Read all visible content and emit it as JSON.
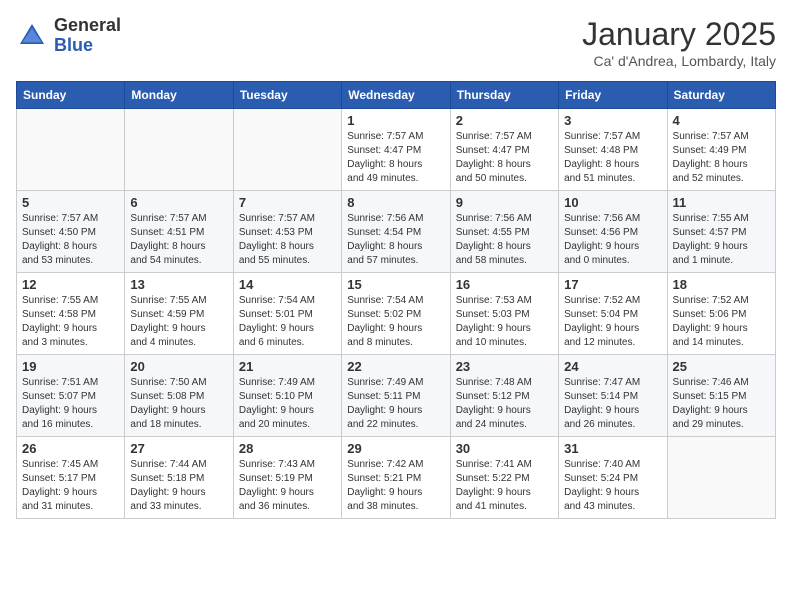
{
  "logo": {
    "general": "General",
    "blue": "Blue"
  },
  "title": "January 2025",
  "subtitle": "Ca' d'Andrea, Lombardy, Italy",
  "days_of_week": [
    "Sunday",
    "Monday",
    "Tuesday",
    "Wednesday",
    "Thursday",
    "Friday",
    "Saturday"
  ],
  "weeks": [
    [
      {
        "day": "",
        "info": ""
      },
      {
        "day": "",
        "info": ""
      },
      {
        "day": "",
        "info": ""
      },
      {
        "day": "1",
        "info": "Sunrise: 7:57 AM\nSunset: 4:47 PM\nDaylight: 8 hours\nand 49 minutes."
      },
      {
        "day": "2",
        "info": "Sunrise: 7:57 AM\nSunset: 4:47 PM\nDaylight: 8 hours\nand 50 minutes."
      },
      {
        "day": "3",
        "info": "Sunrise: 7:57 AM\nSunset: 4:48 PM\nDaylight: 8 hours\nand 51 minutes."
      },
      {
        "day": "4",
        "info": "Sunrise: 7:57 AM\nSunset: 4:49 PM\nDaylight: 8 hours\nand 52 minutes."
      }
    ],
    [
      {
        "day": "5",
        "info": "Sunrise: 7:57 AM\nSunset: 4:50 PM\nDaylight: 8 hours\nand 53 minutes."
      },
      {
        "day": "6",
        "info": "Sunrise: 7:57 AM\nSunset: 4:51 PM\nDaylight: 8 hours\nand 54 minutes."
      },
      {
        "day": "7",
        "info": "Sunrise: 7:57 AM\nSunset: 4:53 PM\nDaylight: 8 hours\nand 55 minutes."
      },
      {
        "day": "8",
        "info": "Sunrise: 7:56 AM\nSunset: 4:54 PM\nDaylight: 8 hours\nand 57 minutes."
      },
      {
        "day": "9",
        "info": "Sunrise: 7:56 AM\nSunset: 4:55 PM\nDaylight: 8 hours\nand 58 minutes."
      },
      {
        "day": "10",
        "info": "Sunrise: 7:56 AM\nSunset: 4:56 PM\nDaylight: 9 hours\nand 0 minutes."
      },
      {
        "day": "11",
        "info": "Sunrise: 7:55 AM\nSunset: 4:57 PM\nDaylight: 9 hours\nand 1 minute."
      }
    ],
    [
      {
        "day": "12",
        "info": "Sunrise: 7:55 AM\nSunset: 4:58 PM\nDaylight: 9 hours\nand 3 minutes."
      },
      {
        "day": "13",
        "info": "Sunrise: 7:55 AM\nSunset: 4:59 PM\nDaylight: 9 hours\nand 4 minutes."
      },
      {
        "day": "14",
        "info": "Sunrise: 7:54 AM\nSunset: 5:01 PM\nDaylight: 9 hours\nand 6 minutes."
      },
      {
        "day": "15",
        "info": "Sunrise: 7:54 AM\nSunset: 5:02 PM\nDaylight: 9 hours\nand 8 minutes."
      },
      {
        "day": "16",
        "info": "Sunrise: 7:53 AM\nSunset: 5:03 PM\nDaylight: 9 hours\nand 10 minutes."
      },
      {
        "day": "17",
        "info": "Sunrise: 7:52 AM\nSunset: 5:04 PM\nDaylight: 9 hours\nand 12 minutes."
      },
      {
        "day": "18",
        "info": "Sunrise: 7:52 AM\nSunset: 5:06 PM\nDaylight: 9 hours\nand 14 minutes."
      }
    ],
    [
      {
        "day": "19",
        "info": "Sunrise: 7:51 AM\nSunset: 5:07 PM\nDaylight: 9 hours\nand 16 minutes."
      },
      {
        "day": "20",
        "info": "Sunrise: 7:50 AM\nSunset: 5:08 PM\nDaylight: 9 hours\nand 18 minutes."
      },
      {
        "day": "21",
        "info": "Sunrise: 7:49 AM\nSunset: 5:10 PM\nDaylight: 9 hours\nand 20 minutes."
      },
      {
        "day": "22",
        "info": "Sunrise: 7:49 AM\nSunset: 5:11 PM\nDaylight: 9 hours\nand 22 minutes."
      },
      {
        "day": "23",
        "info": "Sunrise: 7:48 AM\nSunset: 5:12 PM\nDaylight: 9 hours\nand 24 minutes."
      },
      {
        "day": "24",
        "info": "Sunrise: 7:47 AM\nSunset: 5:14 PM\nDaylight: 9 hours\nand 26 minutes."
      },
      {
        "day": "25",
        "info": "Sunrise: 7:46 AM\nSunset: 5:15 PM\nDaylight: 9 hours\nand 29 minutes."
      }
    ],
    [
      {
        "day": "26",
        "info": "Sunrise: 7:45 AM\nSunset: 5:17 PM\nDaylight: 9 hours\nand 31 minutes."
      },
      {
        "day": "27",
        "info": "Sunrise: 7:44 AM\nSunset: 5:18 PM\nDaylight: 9 hours\nand 33 minutes."
      },
      {
        "day": "28",
        "info": "Sunrise: 7:43 AM\nSunset: 5:19 PM\nDaylight: 9 hours\nand 36 minutes."
      },
      {
        "day": "29",
        "info": "Sunrise: 7:42 AM\nSunset: 5:21 PM\nDaylight: 9 hours\nand 38 minutes."
      },
      {
        "day": "30",
        "info": "Sunrise: 7:41 AM\nSunset: 5:22 PM\nDaylight: 9 hours\nand 41 minutes."
      },
      {
        "day": "31",
        "info": "Sunrise: 7:40 AM\nSunset: 5:24 PM\nDaylight: 9 hours\nand 43 minutes."
      },
      {
        "day": "",
        "info": ""
      }
    ]
  ]
}
